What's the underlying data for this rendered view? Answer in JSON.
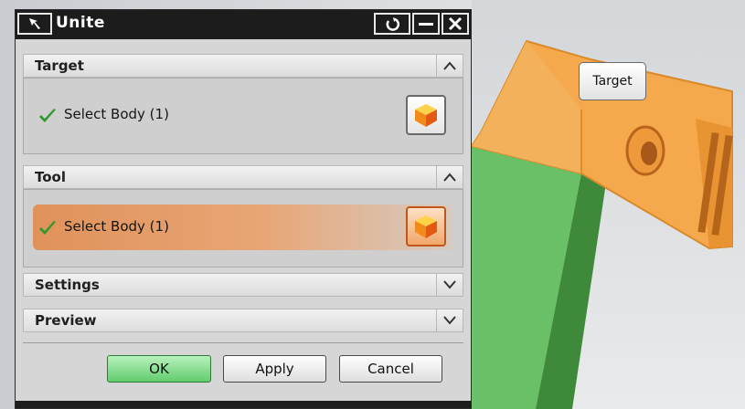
{
  "dialog": {
    "title": "Unite",
    "icons": {
      "reset": "reset-icon",
      "minimize": "minimize-icon",
      "close": "close-icon",
      "pin": "select-arrow-icon"
    }
  },
  "sections": {
    "target": {
      "title": "Target",
      "state": "expanded",
      "row_label": "Select Body (1)"
    },
    "tool": {
      "title": "Tool",
      "state": "expanded",
      "row_label": "Select Body (1)"
    },
    "settings": {
      "title": "Settings",
      "state": "collapsed"
    },
    "preview": {
      "title": "Preview",
      "state": "collapsed"
    }
  },
  "buttons": {
    "ok": "OK",
    "apply": "Apply",
    "cancel": "Cancel"
  },
  "viewport": {
    "callout": "Target"
  },
  "colors": {
    "highlight_row": "#e89a5e",
    "selected_body": "#f5a94c",
    "tool_body": "#7cc872",
    "ok_button": "#6fd27a"
  }
}
